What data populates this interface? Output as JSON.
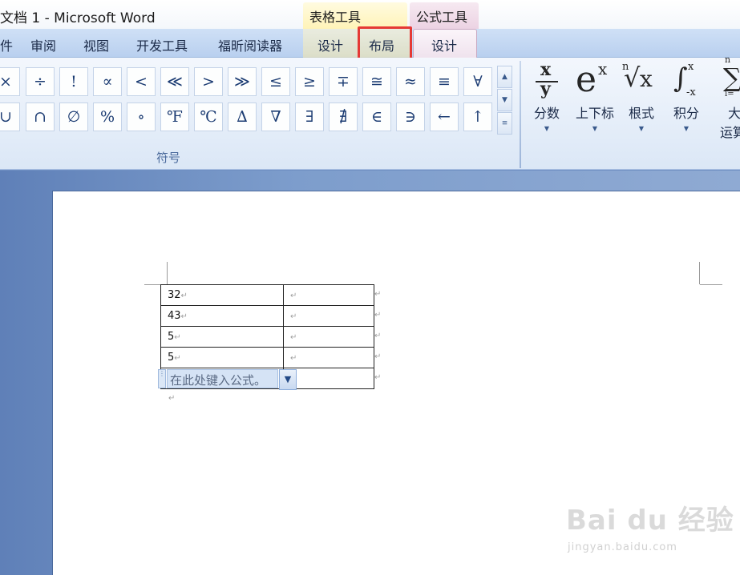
{
  "window": {
    "title": "文档 1 - Microsoft Word"
  },
  "context_tabs": {
    "table_tools": "表格工具",
    "formula_tools": "公式工具"
  },
  "tabs": [
    {
      "label": "件"
    },
    {
      "label": "审阅"
    },
    {
      "label": "视图"
    },
    {
      "label": "开发工具"
    },
    {
      "label": "福昕阅读器"
    },
    {
      "label": "设计"
    },
    {
      "label": "布局"
    },
    {
      "label": "设计"
    }
  ],
  "highlighted_tab": "布局",
  "symbols": {
    "row1": [
      "×",
      "÷",
      "!",
      "∝",
      "<",
      "≪",
      ">",
      "≫",
      "≤",
      "≥",
      "∓",
      "≅",
      "≈",
      "≡",
      "∀"
    ],
    "row2": [
      "∪",
      "∩",
      "∅",
      "%",
      "∘",
      "℉",
      "℃",
      "∆",
      "∇",
      "∃",
      "∄",
      "∈",
      "∋",
      "←",
      "↑"
    ],
    "group_label": "符号"
  },
  "structures": [
    {
      "label": "分数"
    },
    {
      "label": "上下标"
    },
    {
      "label": "根式"
    },
    {
      "label": "积分"
    },
    {
      "label": "大",
      "label2": "运算"
    }
  ],
  "struct_glyphs": {
    "fraction_num": "x",
    "fraction_den": "y",
    "script_base": "e",
    "script_sup": "x",
    "radical_index": "n",
    "radical_symbol": "√",
    "radical_base": "x",
    "integral_symbol": "∫",
    "integral_upper": "x",
    "integral_lower": "-x",
    "large_op_symbol": "∑",
    "large_op_upper": "n",
    "large_op_lower": "i="
  },
  "document": {
    "table": [
      {
        "c1": "32",
        "c2": ""
      },
      {
        "c1": "43",
        "c2": ""
      },
      {
        "c1": "5",
        "c2": ""
      },
      {
        "c1": "5",
        "c2": ""
      }
    ],
    "equation_placeholder": "在此处键入公式。",
    "paragraph_mark": "↵"
  },
  "watermark": {
    "brand": "Bai du 经验",
    "url": "jingyan.baidu.com"
  },
  "colors": {
    "highlight": "#e53935",
    "ribbon_blue": "#b9d0ef",
    "symbol_text": "#1c3c73"
  }
}
